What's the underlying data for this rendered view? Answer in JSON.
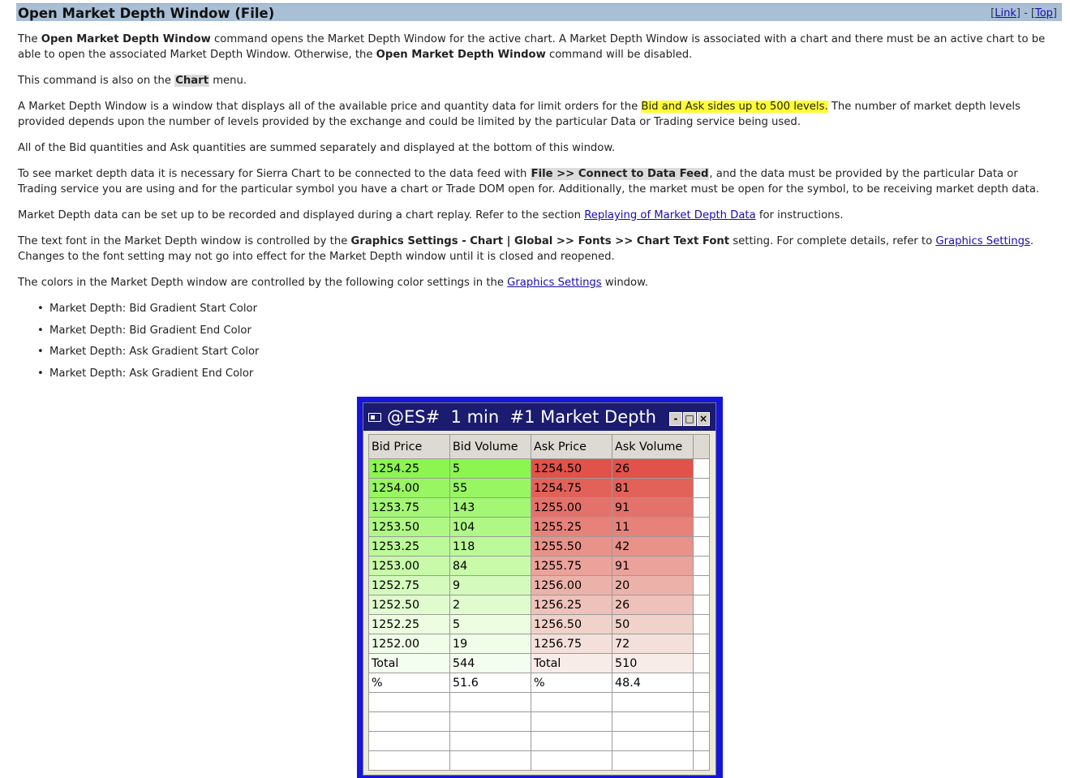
{
  "header": {
    "title": "Open Market Depth Window (File)",
    "link_open": "[",
    "link_label": "Link",
    "link_sep": "] - [",
    "top_label": "Top",
    "link_close": "]"
  },
  "p1": {
    "t1": "The ",
    "b1": "Open Market Depth Window",
    "t2": " command opens the Market Depth Window for the active chart. A Market Depth Window is associated with a chart and there must be an active chart to be able to open the associated Market Depth Window. Otherwise, the ",
    "b2": "Open Market Depth Window",
    "t3": " command will be disabled."
  },
  "p2": {
    "t1": "This command is also on the ",
    "kbd": "Chart",
    "t2": " menu."
  },
  "p3": {
    "t1": "A Market Depth Window is a window that displays all of the available price and quantity data for limit orders for the ",
    "hl": "Bid and Ask sides up to 500 levels.",
    "t2": " The number of market depth levels provided depends upon the number of levels provided by the exchange and could be limited by the particular Data or Trading service being used."
  },
  "p4": "All of the Bid quantities and Ask quantities are summed separately and displayed at the bottom of this window.",
  "p5": {
    "t1": "To see market depth data it is necessary for Sierra Chart to be connected to the data feed with ",
    "kbd": "File >> Connect to Data Feed",
    "t2": ", and the data must be provided by the particular Data or Trading service you are using and for the particular symbol you have a chart or Trade DOM open for. Additionally, the market must be open for the symbol, to be receiving market depth data."
  },
  "p6": {
    "t1": "Market Depth data can be set up to be recorded and displayed during a chart replay. Refer to the section ",
    "link": "Replaying of Market Depth Data",
    "t2": " for instructions."
  },
  "p7": {
    "t1": "The text font in the Market Depth window is controlled by the ",
    "b1": "Graphics Settings - Chart | Global >> Fonts >> Chart Text Font",
    "t2": " setting. For complete details, refer to ",
    "link": "Graphics Settings",
    "t3": ". Changes to the font setting may not go into effect for the Market Depth window until it is closed and reopened."
  },
  "p8": {
    "t1": "The colors in the Market Depth window are controlled by the following color settings in the ",
    "link": "Graphics Settings",
    "t2": " window."
  },
  "color_settings": [
    "Market Depth: Bid Gradient Start Color",
    "Market Depth: Bid Gradient End Color",
    "Market Depth: Ask Gradient Start Color",
    "Market Depth: Ask Gradient End Color"
  ],
  "md_window": {
    "title": "@ES#  1 min  #1 Market Depth",
    "minimize": "-",
    "restore": "□",
    "close": "×",
    "columns": [
      "Bid Price",
      "Bid Volume",
      "Ask Price",
      "Ask Volume"
    ],
    "rows": [
      [
        "1254.25",
        "5",
        "1254.50",
        "26"
      ],
      [
        "1254.00",
        "55",
        "1254.75",
        "81"
      ],
      [
        "1253.75",
        "143",
        "1255.00",
        "91"
      ],
      [
        "1253.50",
        "104",
        "1255.25",
        "11"
      ],
      [
        "1253.25",
        "118",
        "1255.50",
        "42"
      ],
      [
        "1253.00",
        "84",
        "1255.75",
        "91"
      ],
      [
        "1252.75",
        "9",
        "1256.00",
        "20"
      ],
      [
        "1252.50",
        "2",
        "1256.25",
        "26"
      ],
      [
        "1252.25",
        "5",
        "1256.50",
        "50"
      ],
      [
        "1252.00",
        "19",
        "1256.75",
        "72"
      ],
      [
        "Total",
        "544",
        "Total",
        "510"
      ],
      [
        "%",
        "51.6",
        "%",
        "48.4"
      ]
    ],
    "bid_colors": [
      "#8cf550",
      "#98f662",
      "#a4f774",
      "#b0f886",
      "#bcf998",
      "#c8faaa",
      "#d4fbbc",
      "#e0fcce",
      "#ecfde0",
      "#f0fde8",
      "#f4fef0",
      "#ffffff"
    ],
    "ask_colors": [
      "#e0524a",
      "#e2625a",
      "#e4726a",
      "#e6827a",
      "#e8928a",
      "#eaa29a",
      "#ecb2aa",
      "#eec2ba",
      "#f0d2ca",
      "#f4e0da",
      "#f8ece8",
      "#ffffff"
    ]
  }
}
